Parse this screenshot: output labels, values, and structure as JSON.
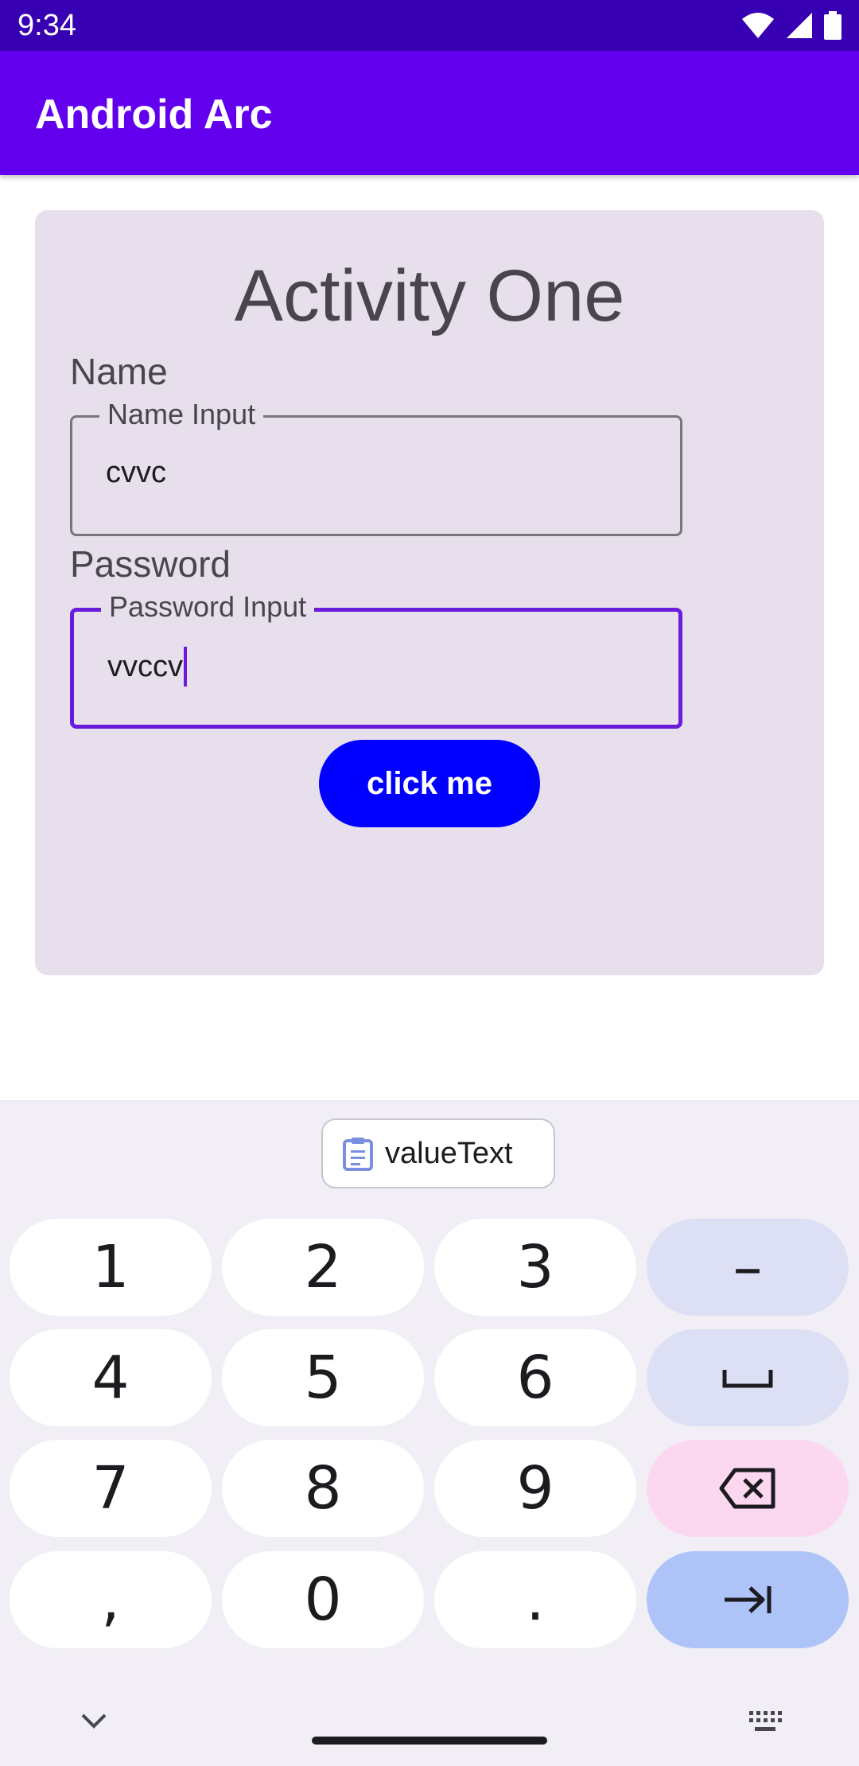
{
  "status_bar": {
    "time": "9:34"
  },
  "app_bar": {
    "title": "Android Arc"
  },
  "screen": {
    "heading": "Activity One",
    "name_label": "Name",
    "name_field": {
      "legend": "Name Input",
      "value": "cvvc"
    },
    "password_label": "Password",
    "password_field": {
      "legend": "Password Input",
      "value": "vvccv"
    },
    "button_label": "click me"
  },
  "keyboard": {
    "suggestion": "valueText",
    "keys": {
      "k1": "1",
      "k2": "2",
      "k3": "3",
      "k4": "4",
      "k5": "5",
      "k6": "6",
      "k7": "7",
      "k8": "8",
      "k9": "9",
      "comma": ",",
      "k0": "0",
      "period": ".",
      "dash": "–"
    }
  },
  "colors": {
    "status_bar": "#3700B3",
    "app_bar": "#6200EE",
    "card": "#E7E0EC",
    "button": "#0000FF",
    "focus": "#6A1BDB"
  },
  "icons": [
    "wifi-icon",
    "signal-icon",
    "battery-icon",
    "clipboard-icon",
    "space-icon",
    "backspace-icon",
    "tab-icon",
    "chevron-down-icon",
    "keyboard-icon"
  ]
}
